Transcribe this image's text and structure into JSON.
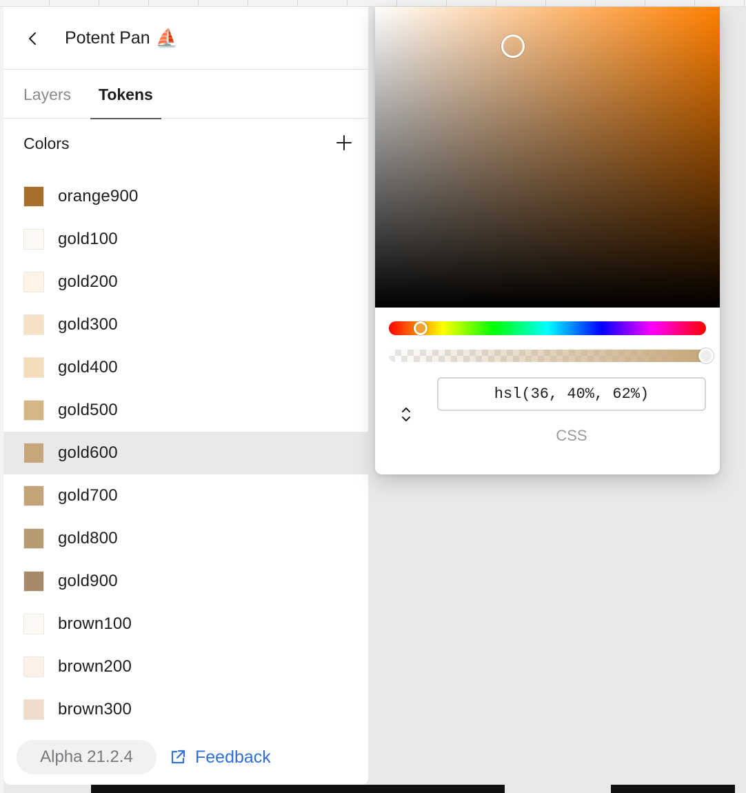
{
  "header": {
    "title": "Potent Pan",
    "title_emoji": "⛵"
  },
  "tabs": [
    {
      "label": "Layers",
      "active": false
    },
    {
      "label": "Tokens",
      "active": true
    }
  ],
  "section": {
    "title": "Colors"
  },
  "colors": [
    {
      "name": "orange900",
      "swatch": "#a96f2c",
      "selected": false
    },
    {
      "name": "gold100",
      "swatch": "#fdf9f4",
      "selected": false
    },
    {
      "name": "gold200",
      "swatch": "#fdf3e6",
      "selected": false
    },
    {
      "name": "gold300",
      "swatch": "#f5e1c5",
      "selected": false
    },
    {
      "name": "gold400",
      "swatch": "#f4ddb9",
      "selected": false
    },
    {
      "name": "gold500",
      "swatch": "#d4b686",
      "selected": false
    },
    {
      "name": "gold600",
      "swatch": "#c5a77b",
      "selected": true
    },
    {
      "name": "gold700",
      "swatch": "#c2a478",
      "selected": false
    },
    {
      "name": "gold800",
      "swatch": "#b59a72",
      "selected": false
    },
    {
      "name": "gold900",
      "swatch": "#a48a68",
      "selected": false
    },
    {
      "name": "brown100",
      "swatch": "#fdf9f5",
      "selected": false
    },
    {
      "name": "brown200",
      "swatch": "#fbf1e8",
      "selected": false
    },
    {
      "name": "brown300",
      "swatch": "#efdccc",
      "selected": false
    }
  ],
  "footer": {
    "version": "Alpha 21.2.4",
    "feedback_label": "Feedback"
  },
  "picker": {
    "value": "hsl(36, 40%, 62%)",
    "format_label": "CSS",
    "hue_fraction": 0.1,
    "alpha_fraction": 1.0,
    "saturation_fraction": 0.4,
    "brightness_fraction": 0.87
  },
  "colors_meta": {
    "accent": "#2f6fd6",
    "selected_row": "#e8e9eb"
  }
}
